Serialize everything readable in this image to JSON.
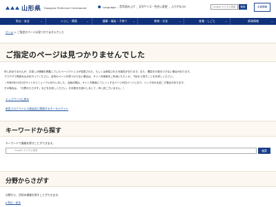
{
  "header": {
    "logo_name": "山形県",
    "logo_sub": "Yamagata Prefecture Government",
    "util": [
      "Language",
      "音声読み上げ",
      "文字サイズ・色合い変更",
      "ふりがなON"
    ],
    "search_placeholder": "Google カスタム検索",
    "search_button": "検索",
    "lang_button": "災害情報"
  },
  "nav": [
    "防災・安全",
    "くらし・環境",
    "健康・福祉・子育て",
    "教育・文化",
    "産業・しごと",
    "県政情報"
  ],
  "breadcrumb": {
    "home": "ホーム",
    "sep": " > ",
    "current": "ご指定のページは見つかりませんでした"
  },
  "title": "ご指定のページは見つかりませんでした",
  "body": {
    "p1": "申し訳ありませんが、お探しの情報を掲載していたページアドレスが変更された、もしくは削除された可能性があります。また、閲覧中の表示できない場合があります。",
    "p2": "ブラウザで再読み込みを行ってください。目的のページが見つからない場合は、サイト内検索をご利用いただくか、下記から探すことをお試しください。",
    "p3": "（令和3年10月1日サイトのリニューアルを行いました。当面の間は、サイト内検索にてヒットするページが旧ページとなり、リンク切れを起こす場合があります。",
    "p4": "その場合は、「分野からさがす」などをお試しください。お手数をお掛けしまして、申し訳ございません。）",
    "top_link": "トップページに戻る",
    "covid_link": "新型コロナウイルス感染症に関連するポータルサイト"
  },
  "keyword": {
    "heading": "キーワードから探す",
    "desc": "キーワードで情報を探すことができます。",
    "placeholder": "Google カスタム検索",
    "button": "検索"
  },
  "field": {
    "heading": "分野からさがす",
    "desc": "分野から、目的の情報を探すことができます。",
    "first_link": "防災・安全"
  }
}
